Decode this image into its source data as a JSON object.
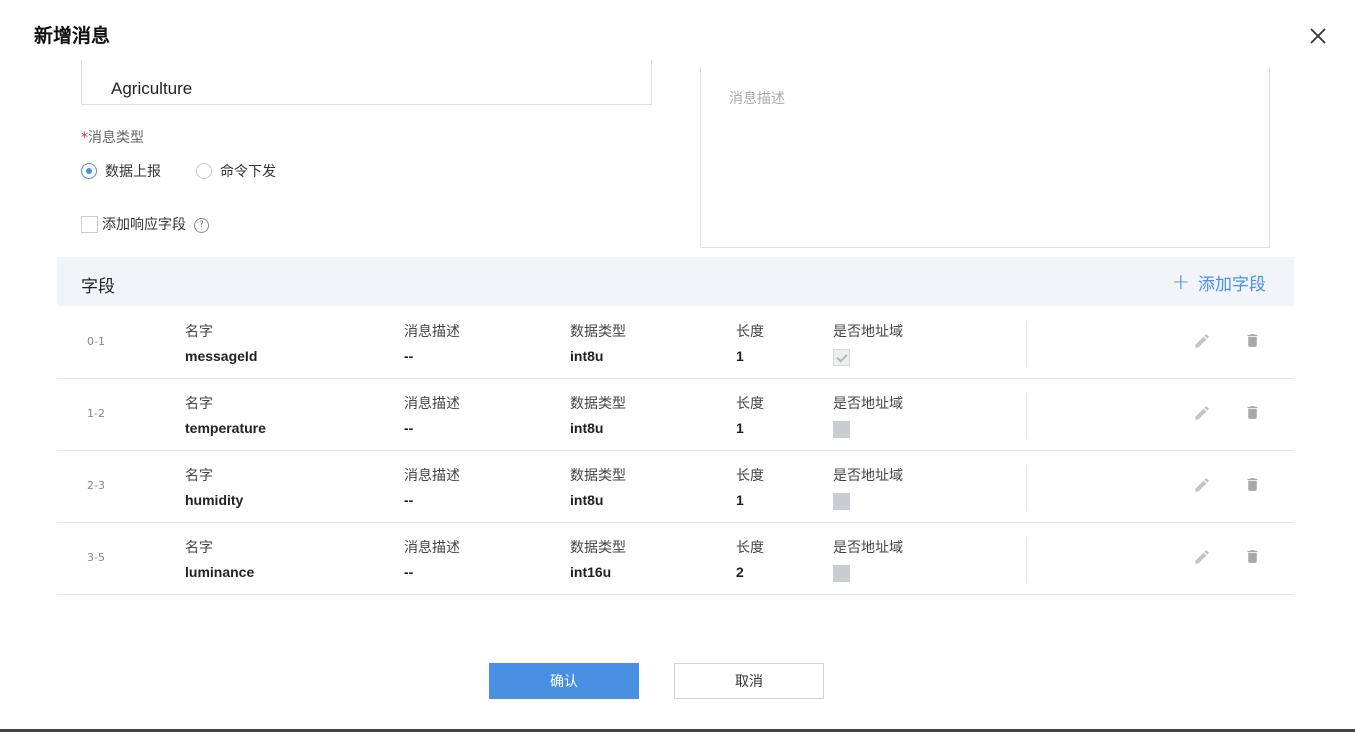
{
  "dialog": {
    "title": "新增消息"
  },
  "form": {
    "name_value": "Agriculture",
    "description_placeholder": "消息描述",
    "required_mark": "*",
    "type_label": "消息类型",
    "type_options": [
      {
        "label": "数据上报",
        "checked": true
      },
      {
        "label": "命令下发",
        "checked": false
      }
    ],
    "response_checkbox_label": "添加响应字段",
    "help_icon_glyph": "?"
  },
  "fields": {
    "title": "字段",
    "add_label": "添加字段",
    "add_icon": "+",
    "column_labels": {
      "name": "名字",
      "description": "消息描述",
      "data_type": "数据类型",
      "length": "长度",
      "is_address": "是否地址域"
    },
    "rows": [
      {
        "range": "0-1",
        "name": "messageId",
        "description": "--",
        "data_type": "int8u",
        "length": "1",
        "is_address": true
      },
      {
        "range": "1-2",
        "name": "temperature",
        "description": "--",
        "data_type": "int8u",
        "length": "1",
        "is_address": false
      },
      {
        "range": "2-3",
        "name": "humidity",
        "description": "--",
        "data_type": "int8u",
        "length": "1",
        "is_address": false
      },
      {
        "range": "3-5",
        "name": "luminance",
        "description": "--",
        "data_type": "int16u",
        "length": "2",
        "is_address": false
      }
    ]
  },
  "footer": {
    "confirm_label": "确认",
    "cancel_label": "取消"
  },
  "colors": {
    "accent": "#4a90e2",
    "header_bg": "#f1f4f8",
    "required": "#e53935"
  },
  "icons": {
    "close": "close-icon",
    "edit": "pencil-icon",
    "delete": "trash-icon",
    "add": "plus-icon",
    "help": "question-icon"
  }
}
